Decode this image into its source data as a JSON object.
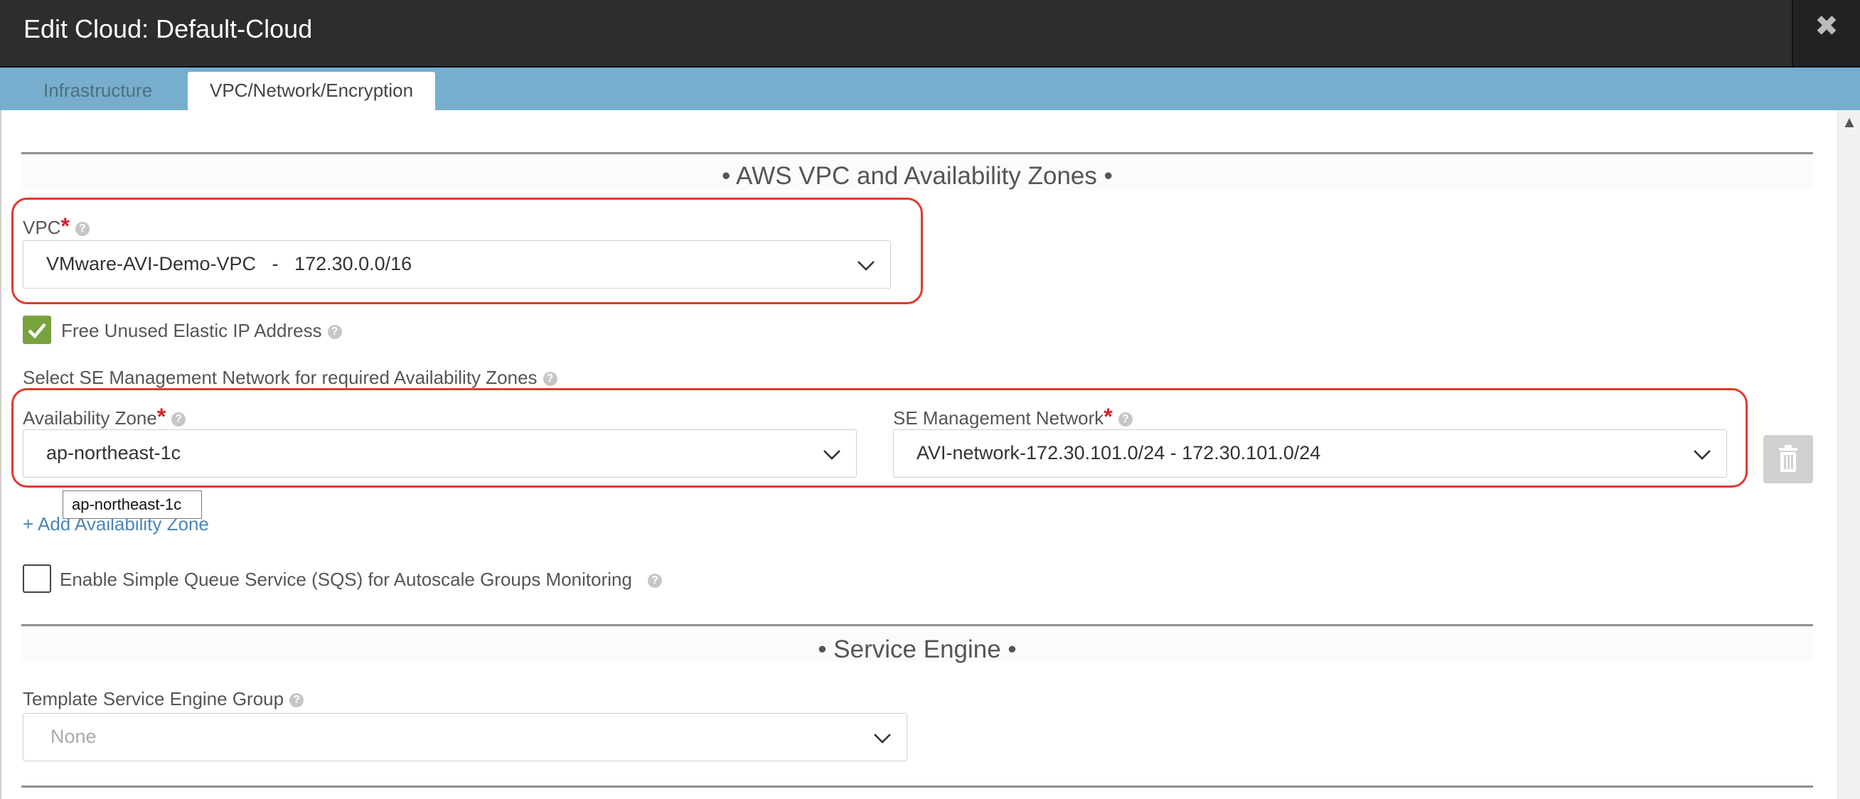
{
  "window": {
    "title": "Edit Cloud: Default-Cloud",
    "close_icon": "close-icon"
  },
  "tabs": [
    {
      "label": "Infrastructure",
      "active": false
    },
    {
      "label": "VPC/Network/Encryption",
      "active": true
    }
  ],
  "aws_section": {
    "title": "• AWS VPC and Availability Zones •",
    "vpc": {
      "label": "VPC",
      "required": "*",
      "value": "VMware-AVI-Demo-VPC   -   172.30.0.0/16"
    },
    "free_elastic_ip": {
      "label": "Free Unused Elastic IP Address",
      "checked": true
    },
    "se_mgmt_heading": "Select SE Management Network for required Availability Zones",
    "availability_zone": {
      "label": "Availability Zone",
      "required": "*",
      "value": "ap-northeast-1c"
    },
    "se_management_network": {
      "label": "SE Management Network",
      "required": "*",
      "value": "AVI-network-172.30.101.0/24 - 172.30.101.0/24"
    },
    "add_zone_link": "+ Add Availability Zone",
    "tooltip": "ap-northeast-1c",
    "sqs": {
      "label": "Enable Simple Queue Service (SQS) for Autoscale Groups Monitoring",
      "checked": false
    }
  },
  "service_engine_section": {
    "title": "• Service Engine •",
    "template_group": {
      "label": "Template Service Engine Group",
      "value": "None"
    }
  },
  "colors": {
    "title_bar": "#2d2d2d",
    "tab_bar": "#77aecd",
    "highlight": "#e13a2b",
    "checkbox_checked": "#78a23e",
    "required": "#d6202a",
    "link": "#4a86b8"
  }
}
